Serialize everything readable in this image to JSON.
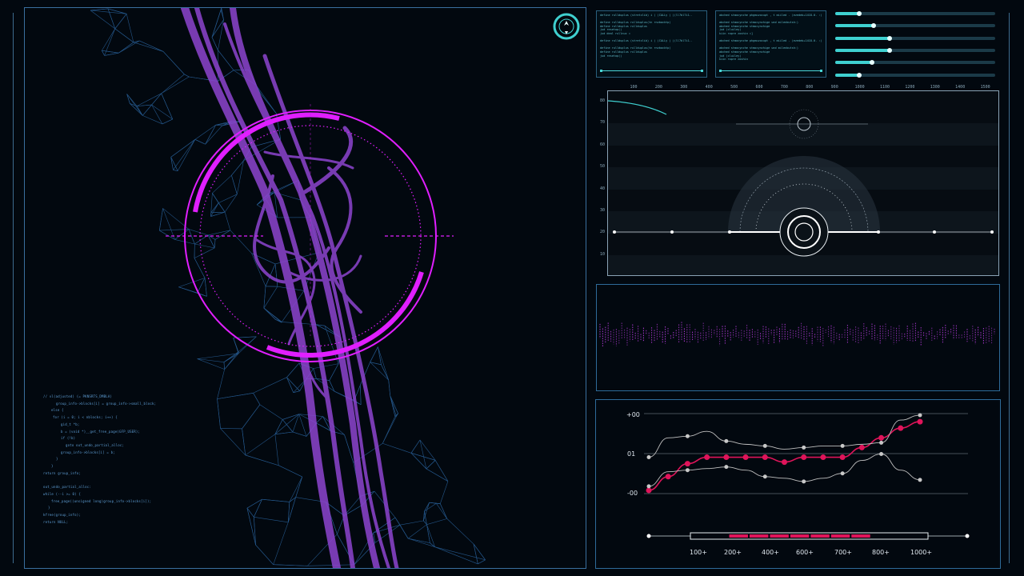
{
  "colors": {
    "background": "#02080f",
    "panel_border": "#2e6b99",
    "magenta": "#e01fff",
    "cyan": "#3fd0d0",
    "crimson": "#e0145a",
    "mesh_blue": "#2f6fb0",
    "vessel_purple": "#9a4ad6"
  },
  "icons": {
    "compass": "compass-icon",
    "target": "targeting-reticle-icon"
  },
  "code_block": [
    "// vl(adjusted) (= PKNSRTS_DMBLA)",
    "group_info->blocks[i] = group_info->small_block;",
    "else {",
    "for (i = 0; i < nblocks; i++) {",
    "gid_t *b;",
    "b = (void *)__get_free_page(GFP_USER);",
    "if (!b)",
    "goto out_undo_partial_alloc;",
    "group_info->blocks[i] = b;",
    "}",
    "}",
    "return group_info;",
    "",
    "out_undo_partial_alloc:",
    "while (--i >= 0) {",
    "free_page((unsigned long)group_info->blocks[i]);",
    "}",
    "kfree(group_info);",
    "return NULL;"
  ],
  "terminals": [
    {
      "lines": [
        "define rullduplus (stretclib) i ( (CALLy ) )(ll7bl7i1..",
        "",
        "define rullduplus rullduplus(tn rnvbacktp(",
        "define rullduplus rullduplus",
        "jud resetop()",
        "jud deal rullnuc =",
        "",
        "define rullduplus (stretclib) i ( (CALLy ) )(ll7bl7i1..",
        "",
        "define rullduplus rullduplus(tn rnvbacktp(",
        "define rullduplus rullduplus",
        "jud resetop()"
      ]
    },
    {
      "lines": [
        "abched stmocynche phgmuvocupt , t miiled . (ezedeb+1418.0. :)",
        "",
        "abched stmocynche stmocynchige und milenbutsh:)",
        "abched stmocynche stmocynchige",
        "jud (cluiley)",
        "kiin ropre zoshin =]",
        "",
        "abched stmocynche phgmuvocupt , t miiled . (ezedeb+1418.0. :)",
        "",
        "abched stmocynche stmocynchige und milenbutsh:)",
        "abched stmocynche stmocynchige",
        "jud (cluiley)",
        "kiin ropre zoshin"
      ]
    }
  ],
  "sliders": [
    0.15,
    0.24,
    0.34,
    0.34,
    0.23,
    0.15
  ],
  "radar_panel": {
    "x_ticks": [
      "100",
      "200",
      "300",
      "400",
      "500",
      "600",
      "700",
      "800",
      "900",
      "1000",
      "1100",
      "1200",
      "1300",
      "1400",
      "1500"
    ],
    "y_ticks": [
      "80",
      "70",
      "60",
      "50",
      "40",
      "30",
      "20",
      "10"
    ]
  },
  "chart_data": {
    "type": "line",
    "y_tick_labels": [
      "+00",
      "01",
      "-00"
    ],
    "x_tick_labels": [
      "100+",
      "200+",
      "400+",
      "600+",
      "700+",
      "800+",
      "1000+"
    ],
    "series": [
      {
        "color": "#e0145a",
        "values": [
          0.05,
          0.22,
          0.38,
          0.46,
          0.46,
          0.46,
          0.46,
          0.4,
          0.46,
          0.46,
          0.46,
          0.58,
          0.7,
          0.82,
          0.9
        ]
      },
      {
        "color": "#bfbfbf",
        "values": [
          0.46,
          0.7,
          0.72,
          0.78,
          0.66,
          0.62,
          0.6,
          0.56,
          0.58,
          0.6,
          0.6,
          0.62,
          0.64,
          0.92,
          0.98
        ]
      },
      {
        "color": "#bfbfbf",
        "values": [
          0.1,
          0.28,
          0.3,
          0.32,
          0.34,
          0.3,
          0.22,
          0.2,
          0.16,
          0.2,
          0.26,
          0.42,
          0.5,
          0.3,
          0.18
        ]
      }
    ]
  },
  "range_bar": {
    "highlight_start": 0.16,
    "highlight_end": 0.76,
    "segments": 7
  }
}
